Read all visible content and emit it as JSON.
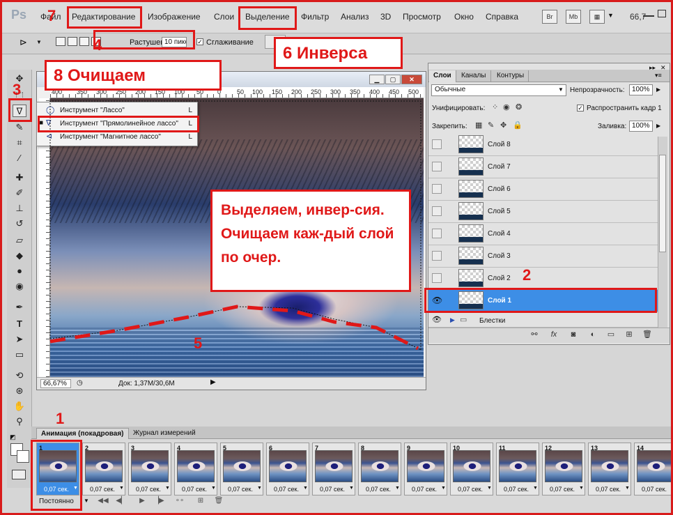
{
  "menubar": {
    "logo": "Ps",
    "items": [
      "Файл",
      "Редактирование",
      "Изображение",
      "Слои",
      "Выделение",
      "Фильтр",
      "Анализ",
      "3D",
      "Просмотр",
      "Окно",
      "Справка"
    ],
    "bridge_icon": "Br",
    "minibridge_icon": "Mb",
    "zoom": "66,7"
  },
  "options": {
    "feather_label": "Растушевка:",
    "feather_value": "10 пикс",
    "antialias_label": "Сглаживание",
    "antialias_checked": "✓"
  },
  "flyout": {
    "items": [
      {
        "label": "Инструмент \"Лассо\"",
        "key": "L",
        "icon": "lasso-icon"
      },
      {
        "label": "Инструмент \"Прямолинейное лассо\"",
        "key": "L",
        "icon": "polygonal-lasso-icon"
      },
      {
        "label": "Инструмент \"Магнитное лассо\"",
        "key": "L",
        "icon": "magnetic-lasso-icon"
      }
    ],
    "active_marker": "■"
  },
  "document": {
    "zoom": "66,67%",
    "doc_size": "Док: 1,37M/30,6M",
    "ruler_marks": [
      "400",
      "350",
      "300",
      "250",
      "200",
      "150",
      "100",
      "50",
      "0",
      "50",
      "100",
      "150",
      "200",
      "250",
      "300",
      "350",
      "400",
      "450",
      "500",
      "550",
      "600"
    ]
  },
  "layers_panel": {
    "tabs": [
      "Слои",
      "Каналы",
      "Контуры"
    ],
    "blend_mode": "Обычные",
    "opacity_label": "Непрозрачность:",
    "opacity_value": "100%",
    "unify_label": "Унифицировать:",
    "propagate_label": "Распространить кадр 1",
    "propagate_checked": "✓",
    "lock_label": "Закрепить:",
    "fill_label": "Заливка:",
    "fill_value": "100%",
    "layers": [
      "Слой 8",
      "Слой 7",
      "Слой 6",
      "Слой 5",
      "Слой 4",
      "Слой 3",
      "Слой 2",
      "Слой 1"
    ],
    "selected_layer": "Слой 1",
    "group_name": "Блестки",
    "eye_glyph": "👁"
  },
  "animation_panel": {
    "tabs": [
      "Анимация (покадровая)",
      "Журнал измерений"
    ],
    "frames": [
      {
        "num": "1",
        "time": "0,07 сек."
      },
      {
        "num": "2",
        "time": "0,07 сек."
      },
      {
        "num": "3",
        "time": "0,07 сек."
      },
      {
        "num": "4",
        "time": "0,07 сек."
      },
      {
        "num": "5",
        "time": "0,07 сек."
      },
      {
        "num": "6",
        "time": "0,07 сек."
      },
      {
        "num": "7",
        "time": "0,07 сек."
      },
      {
        "num": "8",
        "time": "0,07 сек."
      },
      {
        "num": "9",
        "time": "0,07 сек."
      },
      {
        "num": "10",
        "time": "0,07 сек."
      },
      {
        "num": "11",
        "time": "0,07 сек."
      },
      {
        "num": "12",
        "time": "0,07 сек."
      },
      {
        "num": "13",
        "time": "0,07 сек."
      },
      {
        "num": "14",
        "time": "0,07 сек."
      }
    ],
    "loop": "Постоянно"
  },
  "annotations": {
    "n1": "1",
    "n2": "2",
    "n3": "3",
    "n4": "4",
    "n5": "5",
    "n7": "7",
    "step6": "6  Инверса",
    "step8": "8 Очищаем",
    "instruction": "Выделяем, инвер-сия. Очищаем каж-дый слой по очер."
  },
  "colors": {
    "annotation_red": "#e01818",
    "selection_blue": "#3d8ee6"
  }
}
